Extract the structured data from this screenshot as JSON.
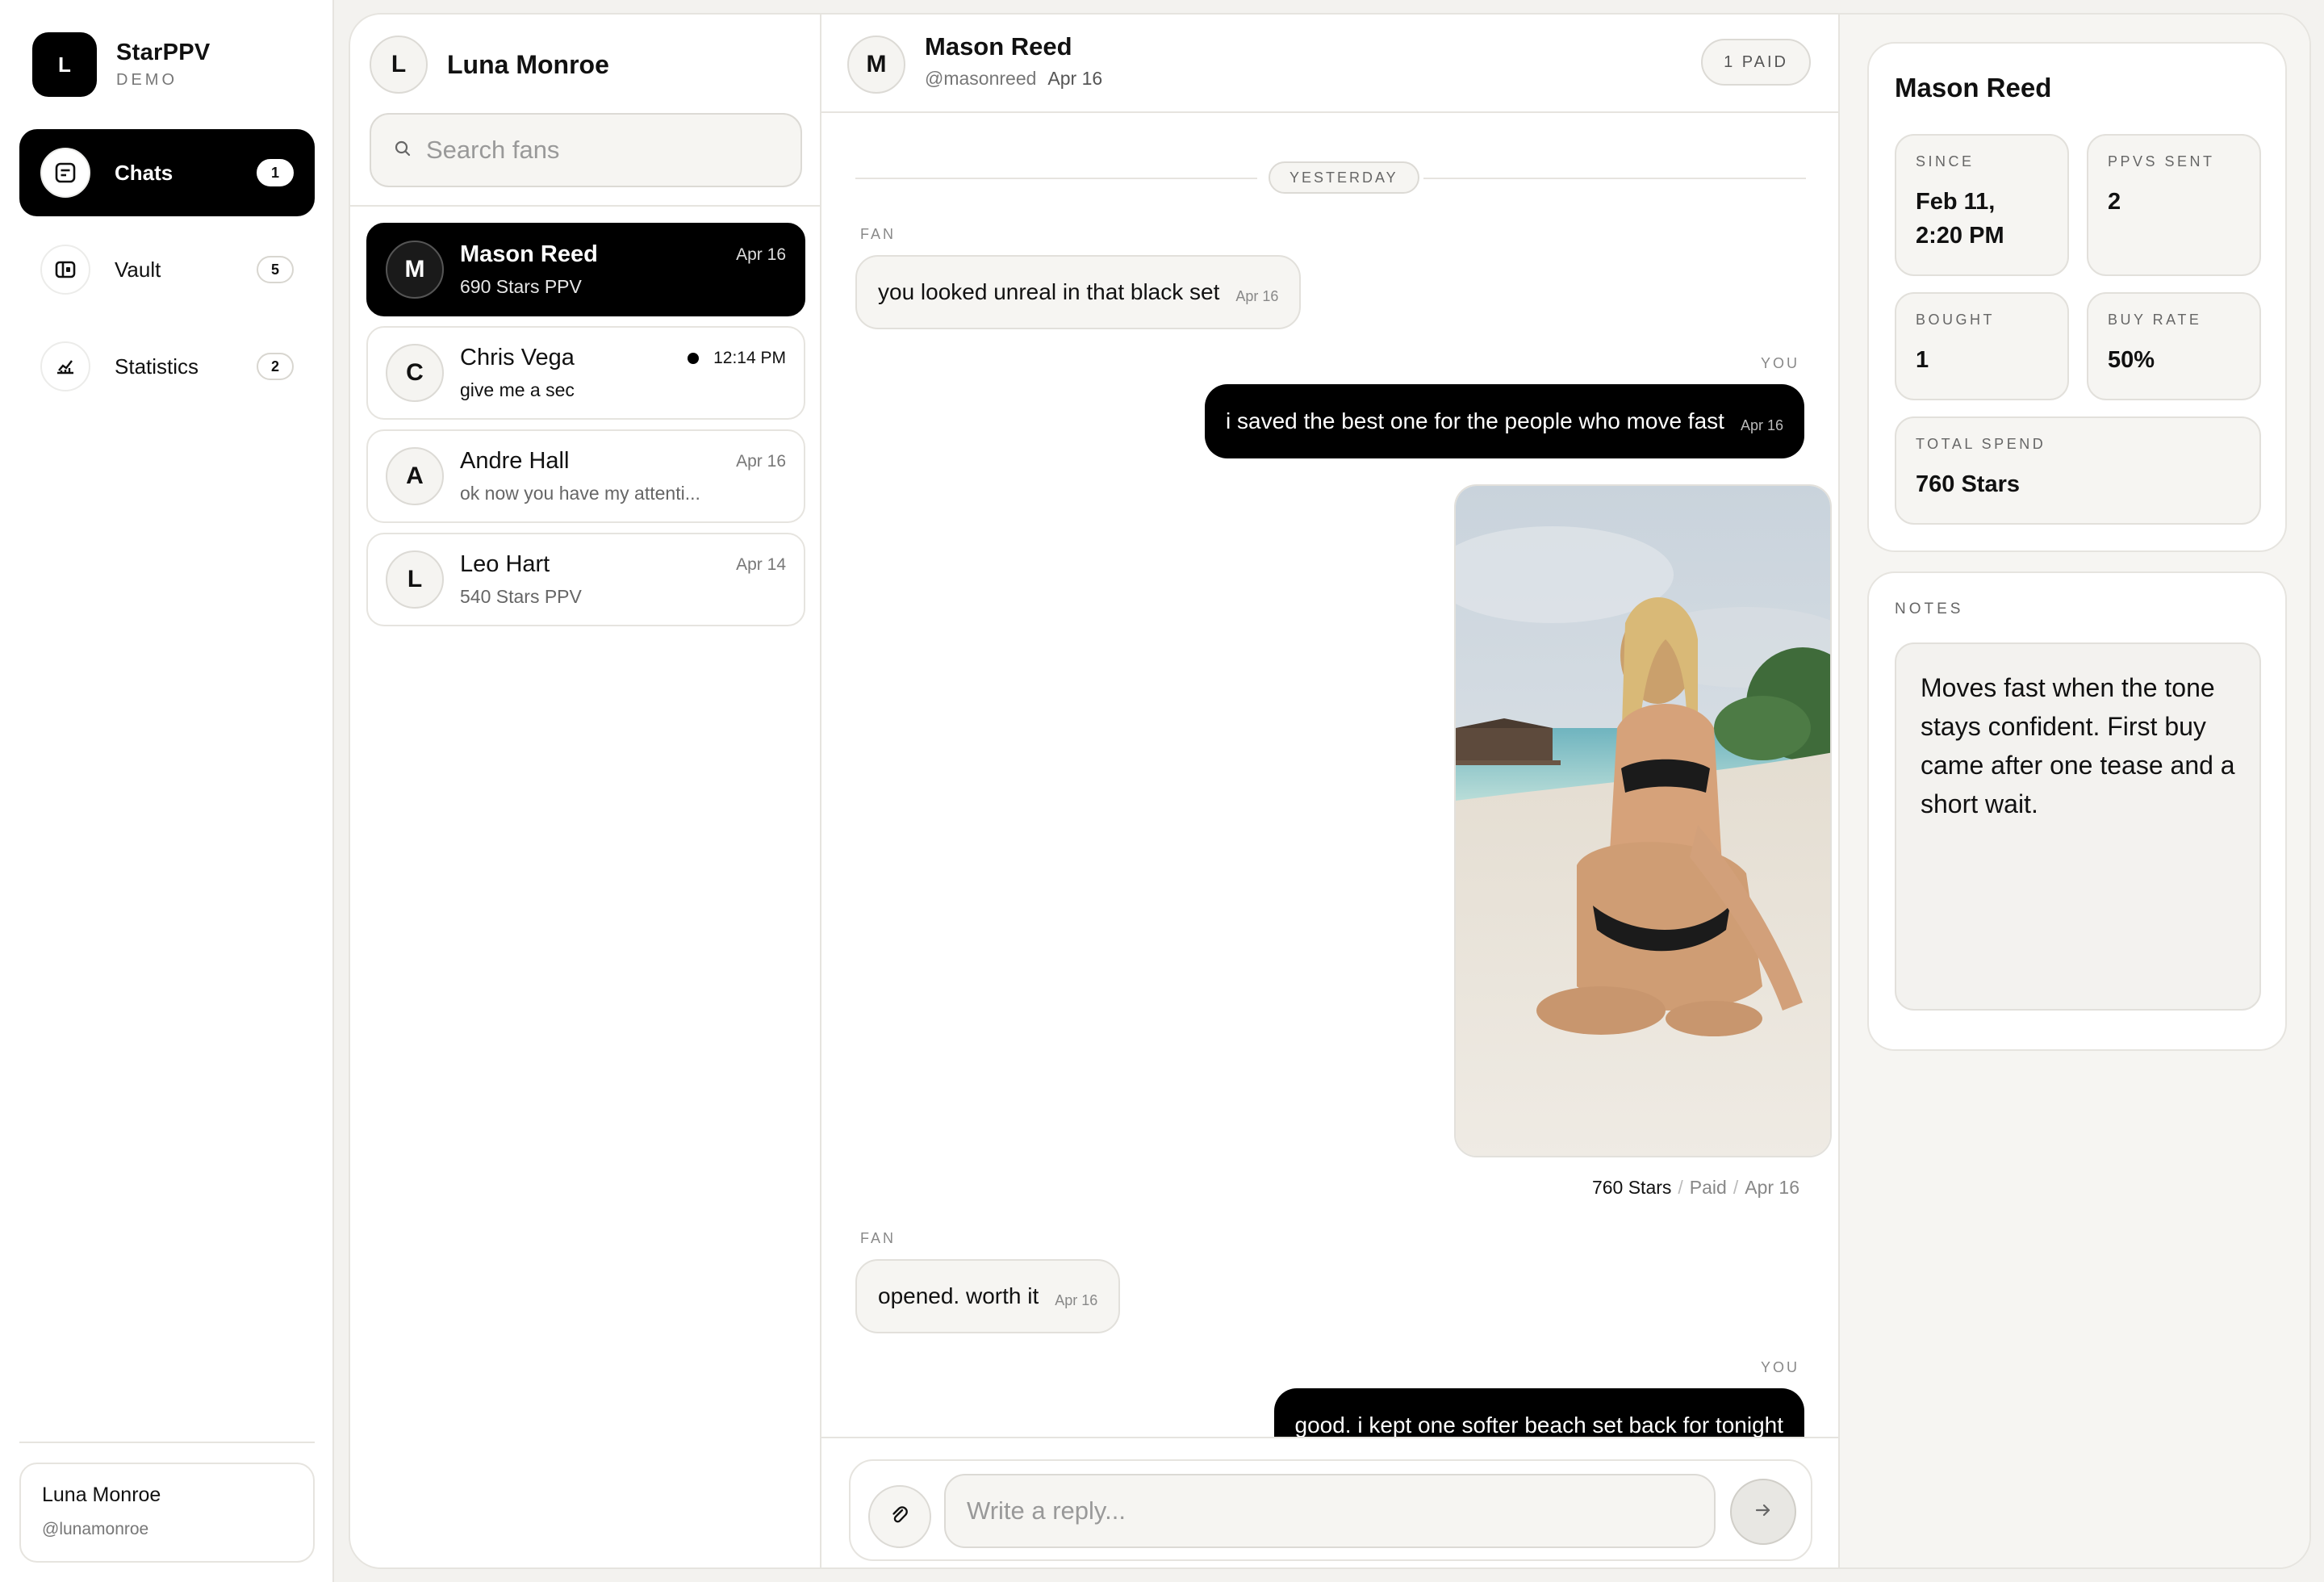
{
  "app": {
    "name": "StarPPV",
    "tagline": "DEMO",
    "logo_letter": "L"
  },
  "nav": {
    "items": [
      {
        "label": "Chats",
        "badge": "1",
        "icon": "chat-icon",
        "active": true
      },
      {
        "label": "Vault",
        "badge": "5",
        "icon": "vault-icon",
        "active": false
      },
      {
        "label": "Statistics",
        "badge": "2",
        "icon": "chart-icon",
        "active": false
      }
    ],
    "user": {
      "name": "Luna Monroe",
      "handle": "@lunamonroe"
    }
  },
  "fan_list": {
    "creator": {
      "initial": "L",
      "name": "Luna Monroe"
    },
    "search_placeholder": "Search fans",
    "fans": [
      {
        "initial": "M",
        "name": "Mason Reed",
        "date": "Apr 16",
        "preview": "690 Stars PPV",
        "active": true,
        "unread": false
      },
      {
        "initial": "C",
        "name": "Chris Vega",
        "date": "12:14 PM",
        "preview": "give me a sec",
        "active": false,
        "unread": true
      },
      {
        "initial": "A",
        "name": "Andre Hall",
        "date": "Apr 16",
        "preview": "ok now you have my attenti...",
        "active": false,
        "unread": false
      },
      {
        "initial": "L",
        "name": "Leo Hart",
        "date": "Apr 14",
        "preview": "540 Stars PPV",
        "active": false,
        "unread": false
      }
    ]
  },
  "chat": {
    "header": {
      "initial": "M",
      "name": "Mason Reed",
      "handle": "@masonreed",
      "date": "Apr 16",
      "paid_badge": "1 PAID"
    },
    "day_separator": "YESTERDAY",
    "messages": [
      {
        "sender_tag": "FAN",
        "text": "you looked unreal in that black set",
        "time": "Apr 16"
      },
      {
        "sender_tag": "YOU",
        "text": "i saved the best one for the people who move fast",
        "time": "Apr 16"
      },
      {
        "media": {
          "price": "760 Stars",
          "status": "Paid",
          "date": "Apr 16"
        }
      },
      {
        "sender_tag": "FAN",
        "text": "opened. worth it",
        "time": "Apr 16"
      },
      {
        "sender_tag": "YOU",
        "text": "good. i kept one softer beach set back for tonight",
        "time": ""
      }
    ],
    "composer": {
      "placeholder": "Write a reply..."
    }
  },
  "details": {
    "fan_name": "Mason Reed",
    "stats": [
      {
        "label": "SINCE",
        "value": "Feb 11, 2:20 PM"
      },
      {
        "label": "PPVS SENT",
        "value": "2"
      },
      {
        "label": "BOUGHT",
        "value": "1"
      },
      {
        "label": "BUY RATE",
        "value": "50%"
      },
      {
        "label": "TOTAL SPEND",
        "value": "760 Stars"
      }
    ],
    "notes_label": "NOTES",
    "notes": "Moves fast when the tone stays confident. First buy came after one tease and a short wait."
  }
}
